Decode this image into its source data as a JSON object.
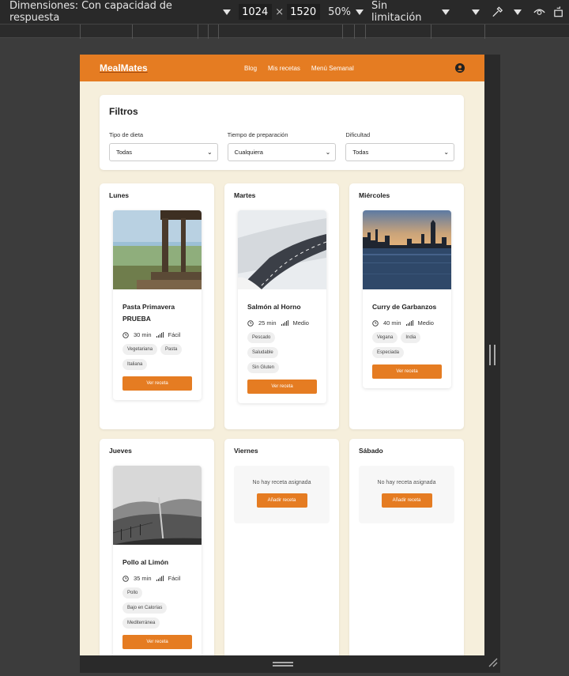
{
  "devtools": {
    "dimensions_label": "Dimensiones: Con capacidad de respuesta",
    "width": "1024",
    "height": "1520",
    "zoom": "50%",
    "throttle": "Sin limitación",
    "times": "×"
  },
  "app": {
    "logo": "MealMates",
    "nav": [
      "Blog",
      "Mis recetas",
      "Menú Semanal"
    ]
  },
  "filters": {
    "title": "Filtros",
    "fields": [
      {
        "label": "Tipo de dieta",
        "value": "Todas"
      },
      {
        "label": "Tiempo de preparación",
        "value": "Cualquiera"
      },
      {
        "label": "Dificultad",
        "value": "Todas"
      }
    ]
  },
  "days": [
    {
      "name": "Lunes",
      "recipe": {
        "title": "Pasta Primavera PRUEBA",
        "time": "30 min",
        "difficulty": "Fácil",
        "tags": [
          "Vegetariana",
          "Pasta",
          "Italiana"
        ],
        "button": "Ver receta"
      }
    },
    {
      "name": "Martes",
      "recipe": {
        "title": "Salmón al Horno",
        "time": "25 min",
        "difficulty": "Medio",
        "tags": [
          "Pescado",
          "Saludable",
          "Sin Gluten"
        ],
        "button": "Ver receta"
      }
    },
    {
      "name": "Miércoles",
      "recipe": {
        "title": "Curry de Garbanzos",
        "time": "40 min",
        "difficulty": "Medio",
        "tags": [
          "Vegana",
          "India",
          "Especiada"
        ],
        "button": "Ver receta"
      }
    },
    {
      "name": "Jueves",
      "recipe": {
        "title": "Pollo al Limón",
        "time": "35 min",
        "difficulty": "Fácil",
        "tags": [
          "Pollo",
          "Bajo en Calorías",
          "Mediterránea"
        ],
        "button": "Ver receta"
      }
    },
    {
      "name": "Viernes",
      "empty_text": "No hay receta asignada",
      "add_button": "Añadir receta"
    },
    {
      "name": "Sábado",
      "empty_text": "No hay receta asignada",
      "add_button": "Añadir receta"
    }
  ],
  "colors": {
    "accent": "#e57c22",
    "background": "#f6efdc"
  }
}
